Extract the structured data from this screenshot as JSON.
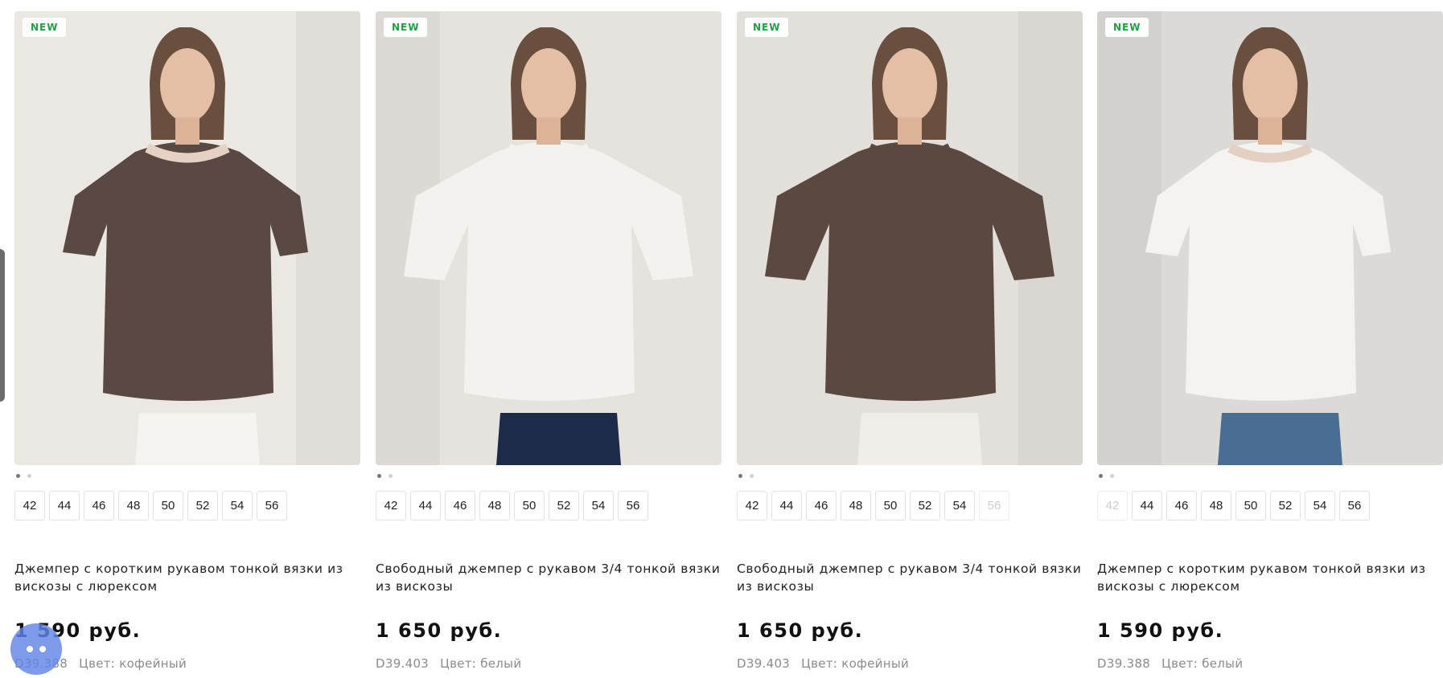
{
  "badge_label": "NEW",
  "products": [
    {
      "id": "p1",
      "title": "Джемпер с коротким рукавом тонкой вязки из вискозы с люрексом",
      "price": "1 590 руб.",
      "article": "D39.388",
      "color": "Цвет: кофейный",
      "shirt_color": "#5a4942",
      "trim_color": "#e6d2c5",
      "bottom_color": "#f6f4f1",
      "background": "#ebe8e3",
      "sizes": [
        {
          "label": "42",
          "available": true
        },
        {
          "label": "44",
          "available": true
        },
        {
          "label": "46",
          "available": true
        },
        {
          "label": "48",
          "available": true
        },
        {
          "label": "50",
          "available": true
        },
        {
          "label": "52",
          "available": true
        },
        {
          "label": "54",
          "available": true
        },
        {
          "label": "56",
          "available": true
        }
      ]
    },
    {
      "id": "p2",
      "title": "Свободный джемпер с рукавом 3/4 тонкой вязки из вискозы",
      "price": "1 650 руб.",
      "article": "D39.403",
      "color": "Цвет: белый",
      "shirt_color": "#f4f2ee",
      "trim_color": "#f4f2ee",
      "bottom_color": "#1e2a4a",
      "background": "#e6e2dd",
      "sizes": [
        {
          "label": "42",
          "available": true
        },
        {
          "label": "44",
          "available": true
        },
        {
          "label": "46",
          "available": true
        },
        {
          "label": "48",
          "available": true
        },
        {
          "label": "50",
          "available": true
        },
        {
          "label": "52",
          "available": true
        },
        {
          "label": "54",
          "available": true
        },
        {
          "label": "56",
          "available": true
        }
      ]
    },
    {
      "id": "p3",
      "title": "Свободный джемпер с рукавом 3/4 тонкой вязки из вискозы",
      "price": "1 650 руб.",
      "article": "D39.403",
      "color": "Цвет: кофейный",
      "shirt_color": "#5b4841",
      "trim_color": "#5b4841",
      "bottom_color": "#f1eeea",
      "background": "#e3dfdb",
      "sizes": [
        {
          "label": "42",
          "available": true
        },
        {
          "label": "44",
          "available": true
        },
        {
          "label": "46",
          "available": true
        },
        {
          "label": "48",
          "available": true
        },
        {
          "label": "50",
          "available": true
        },
        {
          "label": "52",
          "available": true
        },
        {
          "label": "54",
          "available": true
        },
        {
          "label": "56",
          "available": false
        }
      ]
    },
    {
      "id": "p4",
      "title": "Джемпер с коротким рукавом тонкой вязки из вискозы с люрексом",
      "price": "1 590 руб.",
      "article": "D39.388",
      "color": "Цвет: белый",
      "shirt_color": "#f5f3f0",
      "trim_color": "#e4cfc3",
      "bottom_color": "#4a6d94",
      "background": "#dcdad7",
      "sizes": [
        {
          "label": "42",
          "available": false
        },
        {
          "label": "44",
          "available": true
        },
        {
          "label": "46",
          "available": true
        },
        {
          "label": "48",
          "available": true
        },
        {
          "label": "50",
          "available": true
        },
        {
          "label": "52",
          "available": true
        },
        {
          "label": "54",
          "available": true
        },
        {
          "label": "56",
          "available": true
        }
      ]
    }
  ]
}
